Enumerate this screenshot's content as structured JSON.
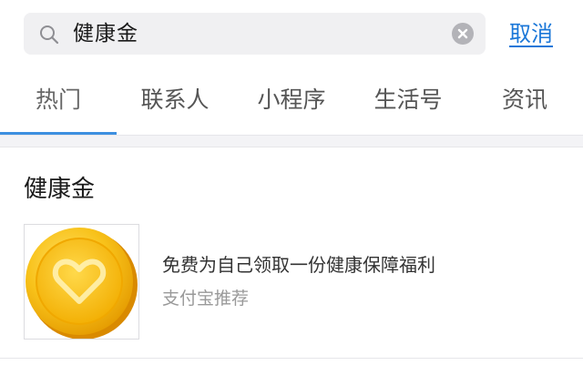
{
  "search": {
    "query": "健康金",
    "cancel_label": "取消"
  },
  "tabs": [
    {
      "label": "热门",
      "active": true
    },
    {
      "label": "联系人",
      "active": false
    },
    {
      "label": "小程序",
      "active": false
    },
    {
      "label": "生活号",
      "active": false
    },
    {
      "label": "资讯",
      "active": false
    }
  ],
  "section": {
    "title": "健康金"
  },
  "result": {
    "icon": "gold-coin-heart-icon",
    "description": "免费为自己领取一份健康保障福利",
    "source": "支付宝推荐"
  },
  "colors": {
    "accent": "#1b77d8",
    "tab_indicator": "#3d8fe0",
    "coin_gold": "#f5b400"
  }
}
